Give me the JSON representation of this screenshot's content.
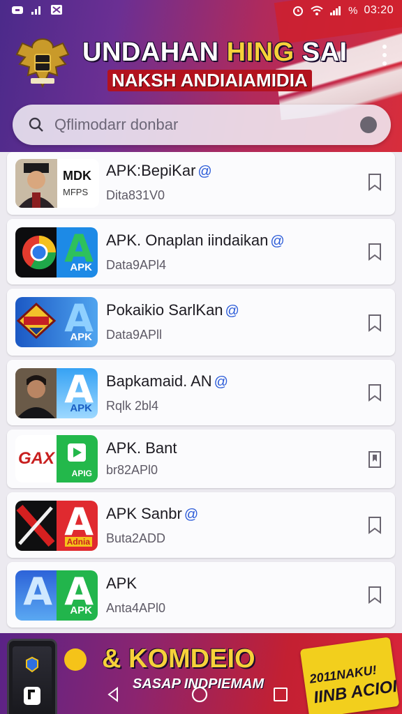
{
  "status": {
    "time": "03:20",
    "battery_pct": "%"
  },
  "header": {
    "title_part1": "UNDAHAN",
    "title_part2": "HING",
    "title_part3": "SAI",
    "subtitle": "NAKSH ANDIAIAMIDIA"
  },
  "search": {
    "placeholder": "Qflimodarr donbar"
  },
  "items": [
    {
      "thumb_left_text": "MDK",
      "thumb_left_sub": "MFPS",
      "title": "APK:BepiKar",
      "title_mark": "@",
      "subtitle": "Dita831V0",
      "bookmark_icon": "bookmark-outline-icon"
    },
    {
      "thumb_label": "APK",
      "title": "APK. Onaplan iindaikan",
      "title_mark": "@",
      "subtitle": "Data9APl4",
      "bookmark_icon": "bookmark-outline-icon"
    },
    {
      "thumb_label": "APK",
      "title": "Pokaikio SarlKan",
      "title_mark": "@",
      "subtitle": "Data9APll",
      "bookmark_icon": "bookmark-outline-icon"
    },
    {
      "thumb_label": "APK",
      "title": "Bapkamaid. AN",
      "title_mark": "@",
      "subtitle": "Rqlk 2bl4",
      "bookmark_icon": "bookmark-outline-icon"
    },
    {
      "thumb_left_text": "GAX",
      "thumb_label": "APIG",
      "title": "APK. Bant",
      "title_mark": "",
      "subtitle": "br82APl0",
      "bookmark_icon": "bookmark-filled-icon"
    },
    {
      "thumb_label": "Adnia",
      "title": "APK Sanbr",
      "title_mark": "@",
      "subtitle": "Buta2ADD",
      "bookmark_icon": "bookmark-outline-icon"
    },
    {
      "thumb_label": "APK",
      "title": "APK",
      "title_mark": "",
      "subtitle": "Anta4APl0",
      "bookmark_icon": "bookmark-outline-icon"
    }
  ],
  "banner": {
    "title": "& KOMDEIO",
    "subtitle": "SASAP INDPIEMAM",
    "badge_line1": "2011NAKU!",
    "badge_line2": "IINB ACIOI"
  },
  "colors": {
    "accent_purple": "#5a2387",
    "accent_red": "#d82d3b",
    "apk_blue": "#1f8bf0",
    "apk_green": "#24b64a"
  }
}
